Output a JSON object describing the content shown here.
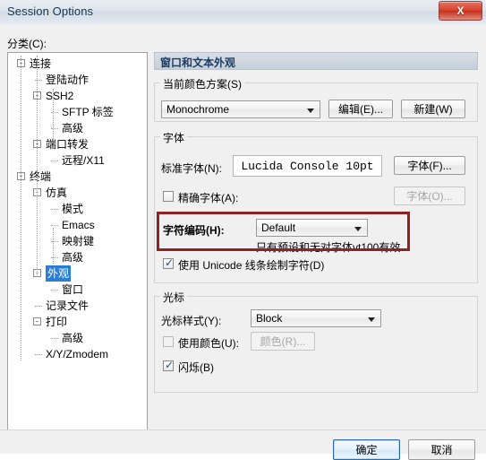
{
  "window": {
    "title": "Session Options",
    "close_icon": "close-icon",
    "close_label": "X",
    "accent_red": "#8f2323",
    "select_blue": "#2a7fd4"
  },
  "sidebar": {
    "label": "分类(C):",
    "items": [
      {
        "label": "连接",
        "depth": 0,
        "expander": "-",
        "selected": false
      },
      {
        "label": "登陆动作",
        "depth": 1,
        "expander": "",
        "selected": false
      },
      {
        "label": "SSH2",
        "depth": 1,
        "expander": "-",
        "selected": false
      },
      {
        "label": "SFTP 标签",
        "depth": 2,
        "expander": "",
        "selected": false
      },
      {
        "label": "高级",
        "depth": 2,
        "expander": "",
        "selected": false
      },
      {
        "label": "端口转发",
        "depth": 1,
        "expander": "-",
        "selected": false
      },
      {
        "label": "远程/X11",
        "depth": 2,
        "expander": "",
        "selected": false
      },
      {
        "label": "终端",
        "depth": 0,
        "expander": "-",
        "selected": false
      },
      {
        "label": "仿真",
        "depth": 1,
        "expander": "-",
        "selected": false
      },
      {
        "label": "模式",
        "depth": 2,
        "expander": "",
        "selected": false
      },
      {
        "label": "Emacs",
        "depth": 2,
        "expander": "",
        "selected": false
      },
      {
        "label": "映射键",
        "depth": 2,
        "expander": "",
        "selected": false
      },
      {
        "label": "高级",
        "depth": 2,
        "expander": "",
        "selected": false
      },
      {
        "label": "外观",
        "depth": 1,
        "expander": "-",
        "selected": true
      },
      {
        "label": "窗口",
        "depth": 2,
        "expander": "",
        "selected": false
      },
      {
        "label": "记录文件",
        "depth": 1,
        "expander": "",
        "selected": false
      },
      {
        "label": "打印",
        "depth": 1,
        "expander": "-",
        "selected": false
      },
      {
        "label": "高级",
        "depth": 2,
        "expander": "",
        "selected": false
      },
      {
        "label": "X/Y/Zmodem",
        "depth": 1,
        "expander": "",
        "selected": false
      }
    ]
  },
  "pane": {
    "header": "窗口和文本外观",
    "color_scheme": {
      "group_title": "当前颜色方案(S)",
      "combo_value": "Monochrome",
      "edit_button": "编辑(E)...",
      "new_button": "新建(W)"
    },
    "font": {
      "group_title": "字体",
      "normal_font_label": "标准字体(N):",
      "normal_font_sample": "Lucida Console 10pt",
      "font_button": "字体(F)...",
      "exact_font_label": "精确字体(A):",
      "exact_font_checked": false,
      "exact_font_button": "字体(O)...",
      "encoding_label": "字符编码(H):",
      "encoding_value": "Default",
      "encoding_hint": "只有预设和无对字体vt100有效",
      "unicode_line_label": "使用 Unicode 线条绘制字符(D)",
      "unicode_line_checked": true
    },
    "cursor": {
      "group_title": "光标",
      "style_label": "光标样式(Y):",
      "style_value": "Block",
      "use_color_label": "使用颜色(U):",
      "use_color_checked": false,
      "color_button": "颜色(R)...",
      "blink_label": "闪烁(B)",
      "blink_checked": true
    }
  },
  "footer": {
    "ok_button": "确定",
    "cancel_button": "取消"
  }
}
